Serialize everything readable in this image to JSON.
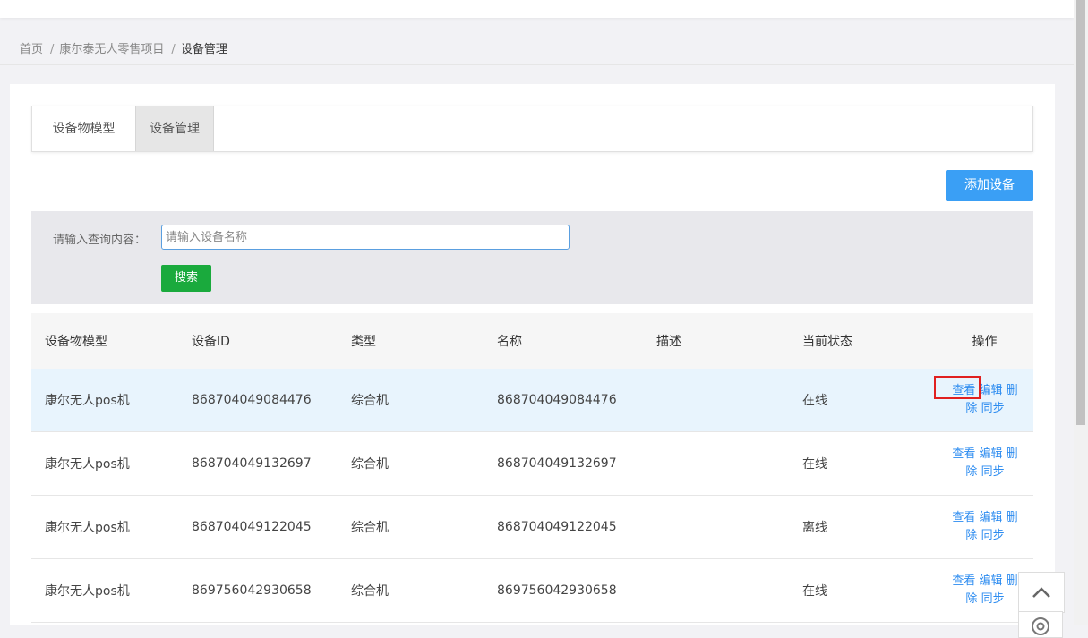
{
  "breadcrumb": [
    {
      "label": "首页"
    },
    {
      "label": "康尔泰无人零售项目"
    },
    {
      "label": "设备管理"
    }
  ],
  "tabs": [
    {
      "label": "设备物模型",
      "active": false
    },
    {
      "label": "设备管理",
      "active": true
    }
  ],
  "toolbar": {
    "add_label": "添加设备"
  },
  "search": {
    "label": "请输入查询内容：",
    "placeholder": "请输入设备名称",
    "value": "",
    "button": "搜索"
  },
  "table": {
    "headers": [
      "设备物模型",
      "设备ID",
      "类型",
      "名称",
      "描述",
      "当前状态",
      "操作"
    ],
    "rows": [
      {
        "model": "康尔无人pos机",
        "id": "868704049084476",
        "type": "综合机",
        "name": "868704049084476",
        "desc": "",
        "status": "在线"
      },
      {
        "model": "康尔无人pos机",
        "id": "868704049132697",
        "type": "综合机",
        "name": "868704049132697",
        "desc": "",
        "status": "在线"
      },
      {
        "model": "康尔无人pos机",
        "id": "868704049122045",
        "type": "综合机",
        "name": "868704049122045",
        "desc": "",
        "status": "离线"
      },
      {
        "model": "康尔无人pos机",
        "id": "869756042930658",
        "type": "综合机",
        "name": "869756042930658",
        "desc": "",
        "status": "在线"
      }
    ],
    "actions": {
      "view": "查看",
      "edit": "编辑",
      "delete": "删除",
      "sync": "同步"
    }
  },
  "colors": {
    "primary": "#3a9ff5",
    "search_button": "#1aaa3d",
    "link": "#2d8cf0",
    "highlight_row": "#e8f4fd",
    "annotation": "#e02020"
  },
  "icons": {
    "back_to_top": "chevron-up-icon",
    "location": "location-icon"
  }
}
